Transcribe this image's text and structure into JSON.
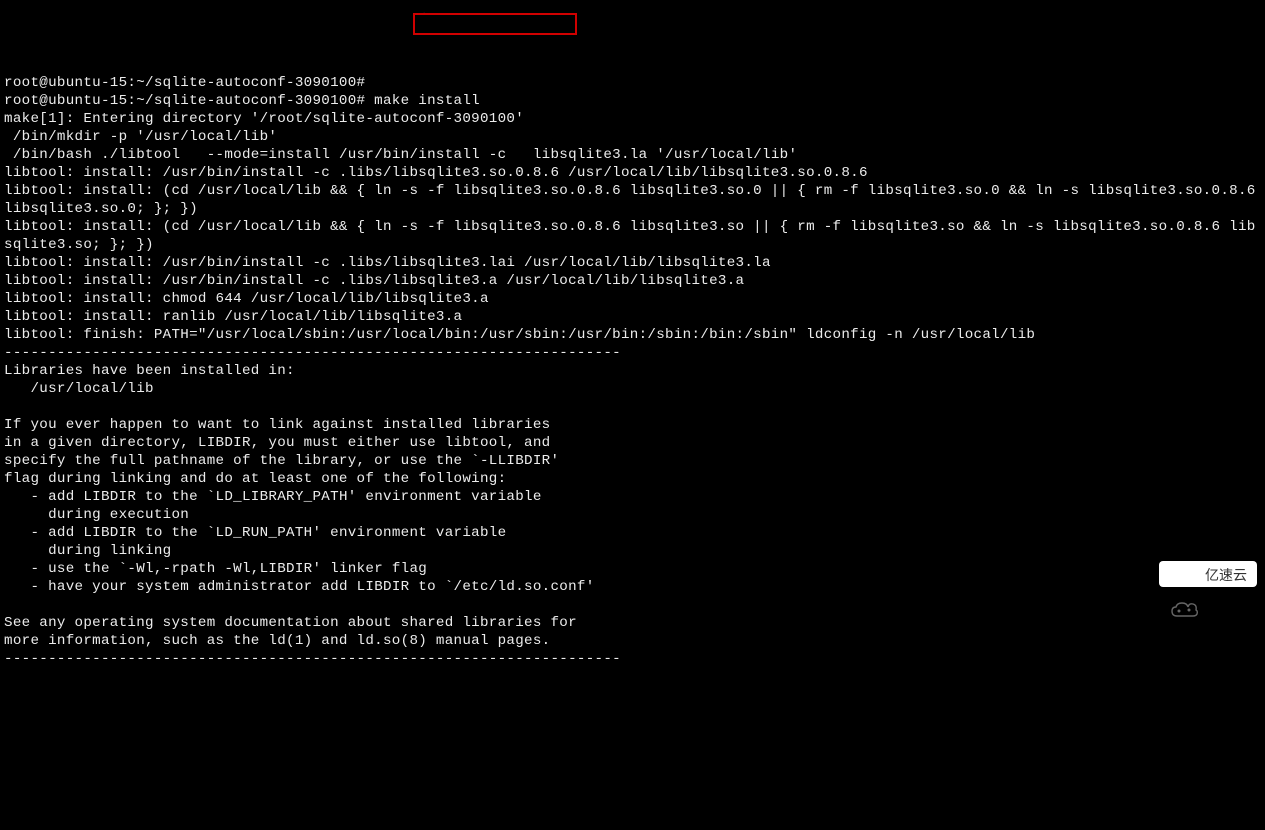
{
  "terminal": {
    "prompt1": "root@ubuntu-15:~/sqlite-autoconf-3090100#",
    "prompt2": "root@ubuntu-15:~/sqlite-autoconf-3090100# make install",
    "lines": [
      "make[1]: Entering directory '/root/sqlite-autoconf-3090100'",
      " /bin/mkdir -p '/usr/local/lib'",
      " /bin/bash ./libtool   --mode=install /usr/bin/install -c   libsqlite3.la '/usr/local/lib'",
      "libtool: install: /usr/bin/install -c .libs/libsqlite3.so.0.8.6 /usr/local/lib/libsqlite3.so.0.8.6",
      "libtool: install: (cd /usr/local/lib && { ln -s -f libsqlite3.so.0.8.6 libsqlite3.so.0 || { rm -f libsqlite3.so.0 && ln -s libsqlite3.so.0.8.6 libsqlite3.so.0; }; })",
      "libtool: install: (cd /usr/local/lib && { ln -s -f libsqlite3.so.0.8.6 libsqlite3.so || { rm -f libsqlite3.so && ln -s libsqlite3.so.0.8.6 libsqlite3.so; }; })",
      "libtool: install: /usr/bin/install -c .libs/libsqlite3.lai /usr/local/lib/libsqlite3.la",
      "libtool: install: /usr/bin/install -c .libs/libsqlite3.a /usr/local/lib/libsqlite3.a",
      "libtool: install: chmod 644 /usr/local/lib/libsqlite3.a",
      "libtool: install: ranlib /usr/local/lib/libsqlite3.a",
      "libtool: finish: PATH=\"/usr/local/sbin:/usr/local/bin:/usr/sbin:/usr/bin:/sbin:/bin:/sbin\" ldconfig -n /usr/local/lib",
      "----------------------------------------------------------------------",
      "Libraries have been installed in:",
      "   /usr/local/lib",
      "",
      "If you ever happen to want to link against installed libraries",
      "in a given directory, LIBDIR, you must either use libtool, and",
      "specify the full pathname of the library, or use the `-LLIBDIR'",
      "flag during linking and do at least one of the following:",
      "   - add LIBDIR to the `LD_LIBRARY_PATH' environment variable",
      "     during execution",
      "   - add LIBDIR to the `LD_RUN_PATH' environment variable",
      "     during linking",
      "   - use the `-Wl,-rpath -Wl,LIBDIR' linker flag",
      "   - have your system administrator add LIBDIR to `/etc/ld.so.conf'",
      "",
      "See any operating system documentation about shared libraries for",
      "more information, such as the ld(1) and ld.so(8) manual pages.",
      "----------------------------------------------------------------------"
    ]
  },
  "watermark": {
    "text": "亿速云"
  }
}
